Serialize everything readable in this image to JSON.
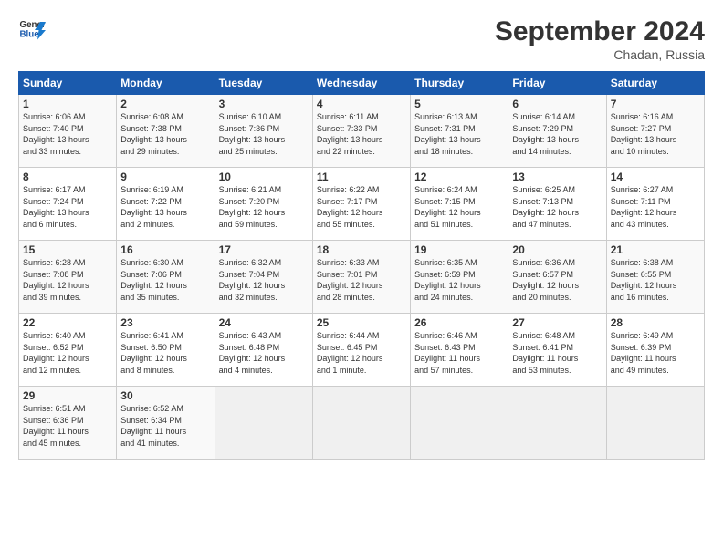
{
  "header": {
    "logo_line1": "General",
    "logo_line2": "Blue",
    "month": "September 2024",
    "location": "Chadan, Russia"
  },
  "weekdays": [
    "Sunday",
    "Monday",
    "Tuesday",
    "Wednesday",
    "Thursday",
    "Friday",
    "Saturday"
  ],
  "weeks": [
    [
      {
        "day": "1",
        "info": "Sunrise: 6:06 AM\nSunset: 7:40 PM\nDaylight: 13 hours\nand 33 minutes."
      },
      {
        "day": "2",
        "info": "Sunrise: 6:08 AM\nSunset: 7:38 PM\nDaylight: 13 hours\nand 29 minutes."
      },
      {
        "day": "3",
        "info": "Sunrise: 6:10 AM\nSunset: 7:36 PM\nDaylight: 13 hours\nand 25 minutes."
      },
      {
        "day": "4",
        "info": "Sunrise: 6:11 AM\nSunset: 7:33 PM\nDaylight: 13 hours\nand 22 minutes."
      },
      {
        "day": "5",
        "info": "Sunrise: 6:13 AM\nSunset: 7:31 PM\nDaylight: 13 hours\nand 18 minutes."
      },
      {
        "day": "6",
        "info": "Sunrise: 6:14 AM\nSunset: 7:29 PM\nDaylight: 13 hours\nand 14 minutes."
      },
      {
        "day": "7",
        "info": "Sunrise: 6:16 AM\nSunset: 7:27 PM\nDaylight: 13 hours\nand 10 minutes."
      }
    ],
    [
      {
        "day": "8",
        "info": "Sunrise: 6:17 AM\nSunset: 7:24 PM\nDaylight: 13 hours\nand 6 minutes."
      },
      {
        "day": "9",
        "info": "Sunrise: 6:19 AM\nSunset: 7:22 PM\nDaylight: 13 hours\nand 2 minutes."
      },
      {
        "day": "10",
        "info": "Sunrise: 6:21 AM\nSunset: 7:20 PM\nDaylight: 12 hours\nand 59 minutes."
      },
      {
        "day": "11",
        "info": "Sunrise: 6:22 AM\nSunset: 7:17 PM\nDaylight: 12 hours\nand 55 minutes."
      },
      {
        "day": "12",
        "info": "Sunrise: 6:24 AM\nSunset: 7:15 PM\nDaylight: 12 hours\nand 51 minutes."
      },
      {
        "day": "13",
        "info": "Sunrise: 6:25 AM\nSunset: 7:13 PM\nDaylight: 12 hours\nand 47 minutes."
      },
      {
        "day": "14",
        "info": "Sunrise: 6:27 AM\nSunset: 7:11 PM\nDaylight: 12 hours\nand 43 minutes."
      }
    ],
    [
      {
        "day": "15",
        "info": "Sunrise: 6:28 AM\nSunset: 7:08 PM\nDaylight: 12 hours\nand 39 minutes."
      },
      {
        "day": "16",
        "info": "Sunrise: 6:30 AM\nSunset: 7:06 PM\nDaylight: 12 hours\nand 35 minutes."
      },
      {
        "day": "17",
        "info": "Sunrise: 6:32 AM\nSunset: 7:04 PM\nDaylight: 12 hours\nand 32 minutes."
      },
      {
        "day": "18",
        "info": "Sunrise: 6:33 AM\nSunset: 7:01 PM\nDaylight: 12 hours\nand 28 minutes."
      },
      {
        "day": "19",
        "info": "Sunrise: 6:35 AM\nSunset: 6:59 PM\nDaylight: 12 hours\nand 24 minutes."
      },
      {
        "day": "20",
        "info": "Sunrise: 6:36 AM\nSunset: 6:57 PM\nDaylight: 12 hours\nand 20 minutes."
      },
      {
        "day": "21",
        "info": "Sunrise: 6:38 AM\nSunset: 6:55 PM\nDaylight: 12 hours\nand 16 minutes."
      }
    ],
    [
      {
        "day": "22",
        "info": "Sunrise: 6:40 AM\nSunset: 6:52 PM\nDaylight: 12 hours\nand 12 minutes."
      },
      {
        "day": "23",
        "info": "Sunrise: 6:41 AM\nSunset: 6:50 PM\nDaylight: 12 hours\nand 8 minutes."
      },
      {
        "day": "24",
        "info": "Sunrise: 6:43 AM\nSunset: 6:48 PM\nDaylight: 12 hours\nand 4 minutes."
      },
      {
        "day": "25",
        "info": "Sunrise: 6:44 AM\nSunset: 6:45 PM\nDaylight: 12 hours\nand 1 minute."
      },
      {
        "day": "26",
        "info": "Sunrise: 6:46 AM\nSunset: 6:43 PM\nDaylight: 11 hours\nand 57 minutes."
      },
      {
        "day": "27",
        "info": "Sunrise: 6:48 AM\nSunset: 6:41 PM\nDaylight: 11 hours\nand 53 minutes."
      },
      {
        "day": "28",
        "info": "Sunrise: 6:49 AM\nSunset: 6:39 PM\nDaylight: 11 hours\nand 49 minutes."
      }
    ],
    [
      {
        "day": "29",
        "info": "Sunrise: 6:51 AM\nSunset: 6:36 PM\nDaylight: 11 hours\nand 45 minutes."
      },
      {
        "day": "30",
        "info": "Sunrise: 6:52 AM\nSunset: 6:34 PM\nDaylight: 11 hours\nand 41 minutes."
      },
      null,
      null,
      null,
      null,
      null
    ]
  ]
}
